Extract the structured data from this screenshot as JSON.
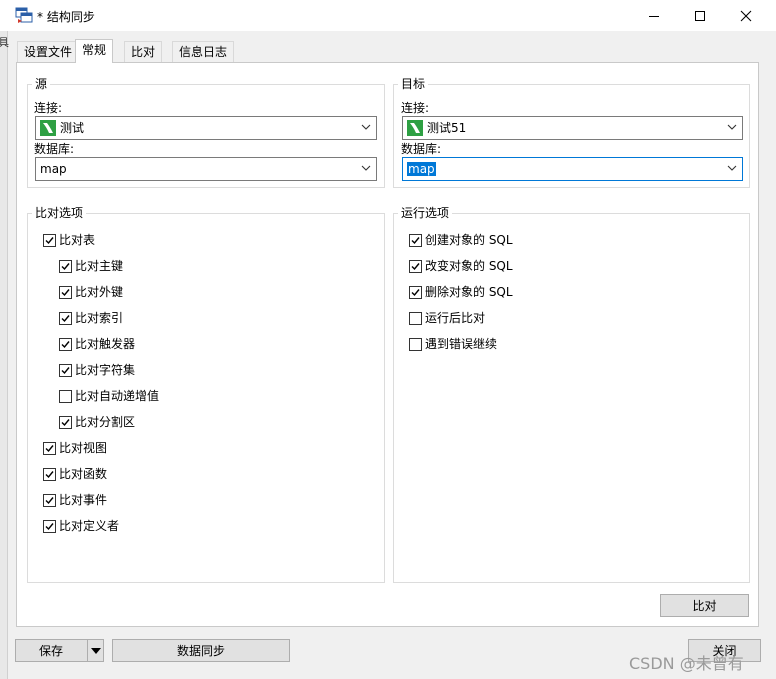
{
  "window": {
    "title": "* 结构同步",
    "minimize_icon": "minimize-icon",
    "maximize_icon": "maximize-icon",
    "close_icon": "close-icon"
  },
  "side_fragment": "具",
  "tabs": [
    {
      "label": "设置文件"
    },
    {
      "label": "常规"
    },
    {
      "label": "比对"
    },
    {
      "label": "信息日志"
    }
  ],
  "active_tab": "常规",
  "source": {
    "group_title": "源",
    "connection_label": "连接:",
    "connection_value": "测试",
    "database_label": "数据库:",
    "database_value": "map"
  },
  "target": {
    "group_title": "目标",
    "connection_label": "连接:",
    "connection_value": "测试51",
    "database_label": "数据库:",
    "database_value": "map"
  },
  "compare_options": {
    "title": "比对选项",
    "items": [
      {
        "label": "比对表",
        "checked": true
      },
      {
        "label": "比对主键",
        "checked": true
      },
      {
        "label": "比对外键",
        "checked": true
      },
      {
        "label": "比对索引",
        "checked": true
      },
      {
        "label": "比对触发器",
        "checked": true
      },
      {
        "label": "比对字符集",
        "checked": true
      },
      {
        "label": "比对自动递增值",
        "checked": false
      },
      {
        "label": "比对分割区",
        "checked": true
      },
      {
        "label": "比对视图",
        "checked": true
      },
      {
        "label": "比对函数",
        "checked": true
      },
      {
        "label": "比对事件",
        "checked": true
      },
      {
        "label": "比对定义者",
        "checked": true
      }
    ]
  },
  "run_options": {
    "title": "运行选项",
    "items": [
      {
        "label": "创建对象的 SQL",
        "checked": true
      },
      {
        "label": "改变对象的 SQL",
        "checked": true
      },
      {
        "label": "删除对象的 SQL",
        "checked": true
      },
      {
        "label": "运行后比对",
        "checked": false
      },
      {
        "label": "遇到错误继续",
        "checked": false
      }
    ]
  },
  "buttons": {
    "compare": "比对",
    "save": "保存",
    "sync": "数据同步",
    "close": "关闭"
  },
  "watermark": "CSDN @未曾有",
  "colors": {
    "accent": "#0078d7",
    "db_icon": "#2ea043"
  }
}
